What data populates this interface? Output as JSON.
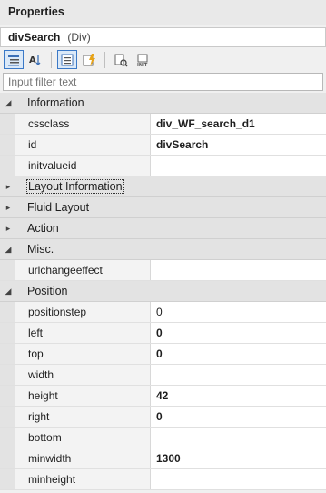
{
  "panel": {
    "title": "Properties"
  },
  "object": {
    "name": "divSearch",
    "type": "(Div)"
  },
  "toolbar": {
    "buttons": [
      {
        "icon": "categorized-icon",
        "active": true
      },
      {
        "icon": "alphabetical-icon",
        "active": false
      },
      {
        "icon": "properties-icon",
        "active": true
      },
      {
        "icon": "events-icon",
        "active": false
      },
      {
        "icon": "property-pages-icon",
        "active": false
      },
      {
        "icon": "init-icon",
        "active": false
      }
    ]
  },
  "filter": {
    "placeholder": "Input filter text"
  },
  "sections": [
    {
      "label": "Information",
      "expanded": true,
      "props": [
        {
          "name": "cssclass",
          "value": "div_WF_search_d1",
          "bold": true
        },
        {
          "name": "id",
          "value": "divSearch",
          "bold": true
        },
        {
          "name": "initvalueid",
          "value": "",
          "bold": false
        }
      ]
    },
    {
      "label": "Layout Information",
      "expanded": false,
      "focused": true,
      "props": []
    },
    {
      "label": "Fluid Layout",
      "expanded": false,
      "props": []
    },
    {
      "label": "Action",
      "expanded": false,
      "props": []
    },
    {
      "label": "Misc.",
      "expanded": true,
      "props": [
        {
          "name": "urlchangeeffect",
          "value": "",
          "bold": false
        }
      ]
    },
    {
      "label": "Position",
      "expanded": true,
      "props": [
        {
          "name": "positionstep",
          "value": "0",
          "bold": false
        },
        {
          "name": "left",
          "value": "0",
          "bold": true
        },
        {
          "name": "top",
          "value": "0",
          "bold": true
        },
        {
          "name": "width",
          "value": "",
          "bold": false
        },
        {
          "name": "height",
          "value": "42",
          "bold": true
        },
        {
          "name": "right",
          "value": "0",
          "bold": true
        },
        {
          "name": "bottom",
          "value": "",
          "bold": false
        },
        {
          "name": "minwidth",
          "value": "1300",
          "bold": true
        },
        {
          "name": "minheight",
          "value": "",
          "bold": false
        }
      ]
    }
  ]
}
